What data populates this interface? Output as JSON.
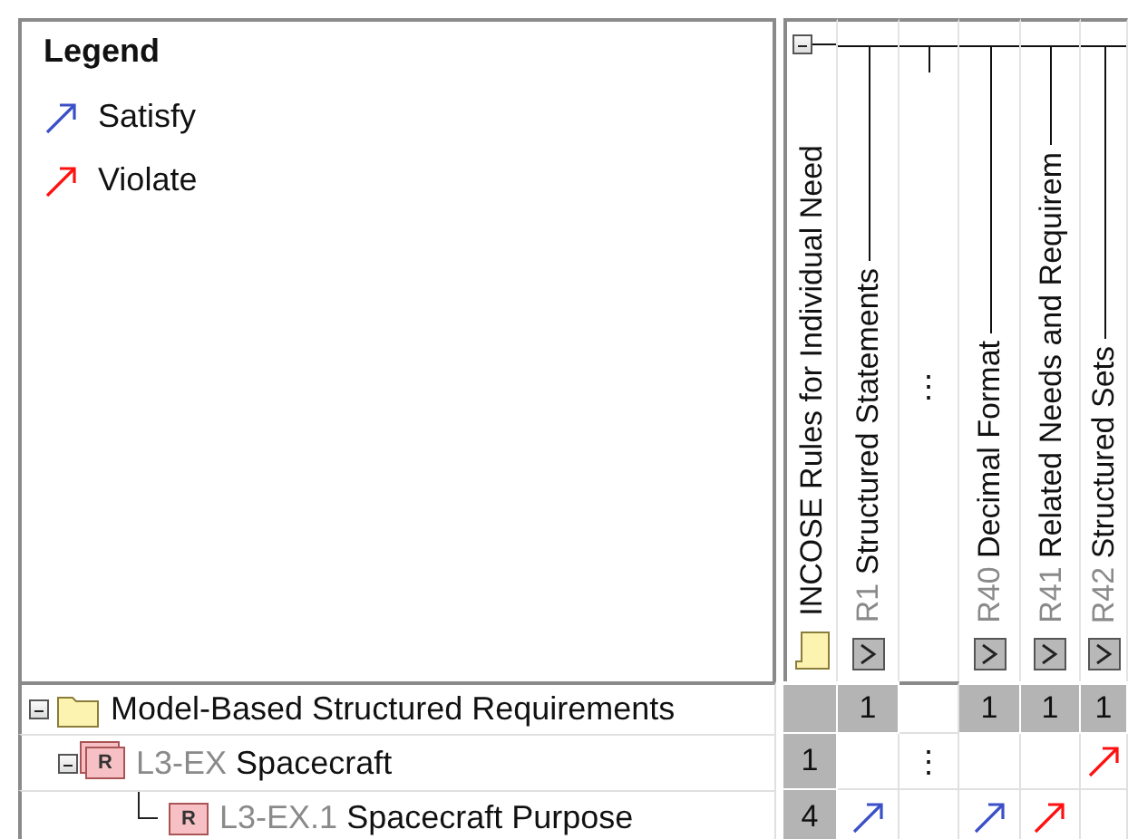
{
  "legend": {
    "title": "Legend",
    "items": [
      {
        "kind": "satisfy",
        "label": "Satisfy"
      },
      {
        "kind": "violate",
        "label": "Violate"
      }
    ]
  },
  "matrix": {
    "columns": [
      {
        "kind": "group",
        "label": "INCOSE Rules for Individual Need",
        "expanded": true
      },
      {
        "kind": "rule",
        "id": "R1",
        "label": "Structured Statements"
      },
      {
        "kind": "more",
        "label": "⋮"
      },
      {
        "kind": "rule",
        "id": "R40",
        "label": "Decimal Format"
      },
      {
        "kind": "rule",
        "id": "R41",
        "label": "Related Needs and Requirem"
      },
      {
        "kind": "rule",
        "id": "R42",
        "label": "Structured Sets"
      }
    ],
    "rows": [
      {
        "kind": "package",
        "label": "Model-Based Structured Requirements",
        "expanded": true,
        "cells": [
          {
            "kind": "total"
          },
          {
            "kind": "total",
            "text": "1"
          },
          {
            "kind": "empty"
          },
          {
            "kind": "total",
            "text": "1"
          },
          {
            "kind": "total",
            "text": "1"
          },
          {
            "kind": "total",
            "text": "1"
          }
        ],
        "children": [
          {
            "kind": "requirement",
            "badge": "R",
            "id": "L3-EX",
            "label": "Spacecraft",
            "expanded": true,
            "cells": [
              {
                "kind": "total",
                "text": "1"
              },
              {
                "kind": "empty"
              },
              {
                "kind": "more",
                "text": "⋮"
              },
              {
                "kind": "empty"
              },
              {
                "kind": "empty"
              },
              {
                "kind": "violate"
              }
            ],
            "children": [
              {
                "kind": "requirement",
                "badge": "R",
                "id": "L3-EX.1",
                "label": "Spacecraft Purpose",
                "cells": [
                  {
                    "kind": "total",
                    "text": "4"
                  },
                  {
                    "kind": "satisfy"
                  },
                  {
                    "kind": "empty"
                  },
                  {
                    "kind": "satisfy"
                  },
                  {
                    "kind": "violate"
                  },
                  {
                    "kind": "empty"
                  }
                ]
              }
            ]
          }
        ]
      }
    ]
  }
}
